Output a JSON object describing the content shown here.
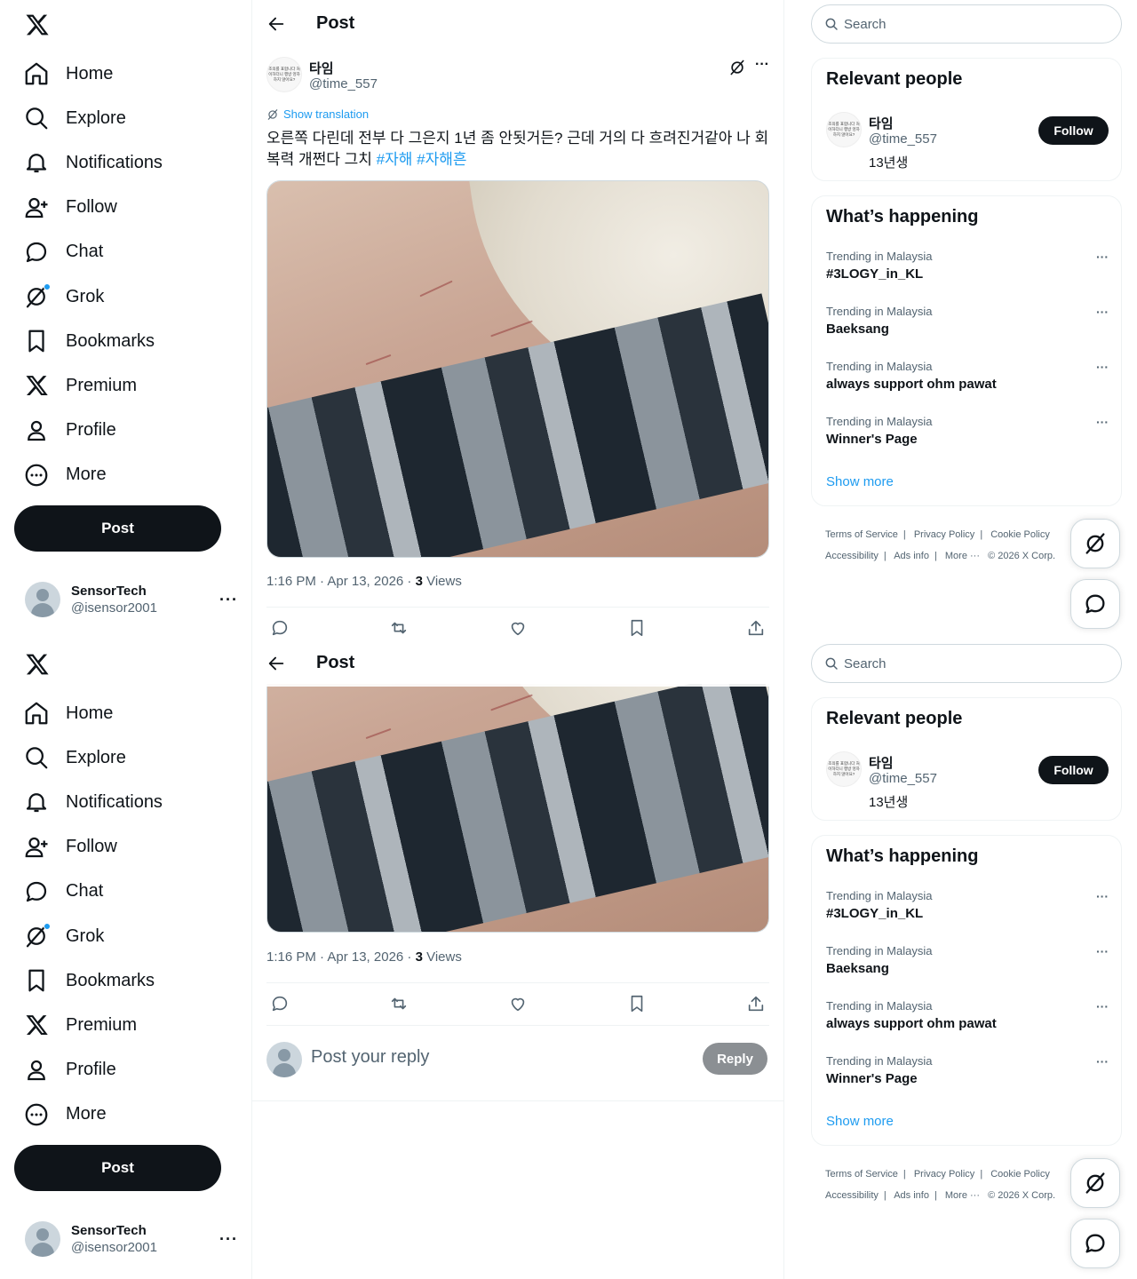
{
  "nav": {
    "items": [
      {
        "label": "Home",
        "icon": "home-icon"
      },
      {
        "label": "Explore",
        "icon": "search-icon"
      },
      {
        "label": "Notifications",
        "icon": "bell-icon"
      },
      {
        "label": "Follow",
        "icon": "add-user-icon"
      },
      {
        "label": "Chat",
        "icon": "chat-bubble-icon"
      },
      {
        "label": "Grok",
        "icon": "grok-icon"
      },
      {
        "label": "Bookmarks",
        "icon": "bookmark-icon"
      },
      {
        "label": "Premium",
        "icon": "x-logo-icon"
      },
      {
        "label": "Profile",
        "icon": "person-icon"
      },
      {
        "label": "More",
        "icon": "more-circle-icon"
      }
    ],
    "post_label": "Post"
  },
  "account": {
    "name": "SensorTech",
    "handle": "@isensor2001",
    "more": "···"
  },
  "main": {
    "title": "Post",
    "tweet": {
      "author_name": "타임",
      "author_handle": "@time_557",
      "avatar_text": "조의를 표합니다 처이하더니 행방 엉하하지 않아요?",
      "show_translation": "Show translation",
      "text": "오른쪽 다린데 전부 다 그은지 1년 좀 안됫거든? 근데 거의 다 흐려진거같아 나 회복력 개쩐다 그치 ",
      "hashtags": [
        "#자해",
        "#자해흔"
      ],
      "time": "1:16 PM · Apr 13, 2026 · ",
      "views_count": "3",
      "views_label": " Views",
      "more": "···"
    },
    "reply_placeholder": "Post your reply",
    "reply_label": "Reply"
  },
  "right": {
    "search_placeholder": "Search",
    "relevant_title": "Relevant people",
    "person": {
      "name": "타임",
      "handle": "@time_557",
      "bio": "13년생",
      "follow_label": "Follow"
    },
    "happening_title": "What’s happening",
    "trends": [
      {
        "context": "Trending in Malaysia",
        "topic": "#3LOGY_in_KL"
      },
      {
        "context": "Trending in Malaysia",
        "topic": "Baeksang"
      },
      {
        "context": "Trending in Malaysia",
        "topic": "always support ohm pawat"
      },
      {
        "context": "Trending in Malaysia",
        "topic": "Winner's Page"
      }
    ],
    "trend_more": "···",
    "show_more": "Show more",
    "footer": {
      "terms": "Terms of Service",
      "privacy": "Privacy Policy",
      "cookie": "Cookie Policy",
      "accessibility": "Accessibility",
      "ads": "Ads info",
      "more": "More ···",
      "copyright": "© 2026 X Corp."
    }
  },
  "colors": {
    "accent": "#1d9bf0",
    "text": "#0f1419",
    "muted": "#536471",
    "border": "#eff3f4"
  }
}
